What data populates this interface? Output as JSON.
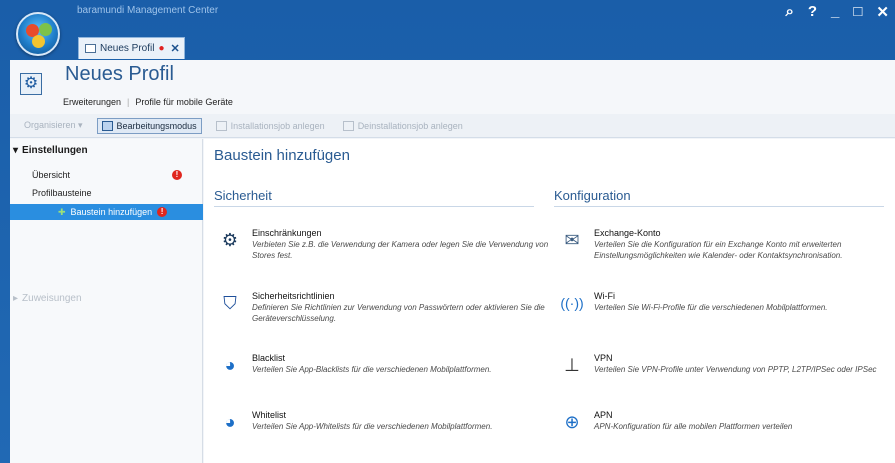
{
  "app": {
    "title": "baramundi Management Center"
  },
  "window_controls": {
    "search": "⌕",
    "help": "?",
    "minimize": "_",
    "maximize": "□",
    "close": "✕"
  },
  "tab": {
    "label": "Neues Profil",
    "modified_marker": "●",
    "close": "✕"
  },
  "header": {
    "title": "Neues Profil",
    "breadcrumb": [
      "Erweiterungen",
      "Profile für mobile Geräte"
    ],
    "breadcrumb_sep": "|"
  },
  "toolbar": {
    "items": [
      {
        "label": "Organisieren ▾",
        "enabled": false
      },
      {
        "label": "Bearbeitungsmodus",
        "enabled": true
      },
      {
        "label": "Installationsjob anlegen",
        "enabled": false
      },
      {
        "label": "Deinstallationsjob anlegen",
        "enabled": false
      }
    ]
  },
  "sidebar": {
    "section1": {
      "label": "Einstellungen",
      "toggle": "▾"
    },
    "items": [
      {
        "label": "Übersicht",
        "error": "!"
      },
      {
        "label": "Profilbausteine"
      },
      {
        "label": "Baustein hinzufügen",
        "error": "!"
      }
    ],
    "section2": {
      "label": "Zuweisungen",
      "toggle": "▸"
    }
  },
  "main": {
    "title": "Baustein hinzufügen",
    "columns": [
      {
        "heading": "Sicherheit",
        "cards": [
          {
            "icon": "gear-icon",
            "title": "Einschränkungen",
            "desc": "Verbieten Sie z.B. die Verwendung der Kamera oder legen Sie die Verwendung von Stores fest."
          },
          {
            "icon": "shield-icon",
            "title": "Sicherheitsrichtlinien",
            "desc": "Definieren Sie Richtlinien zur Verwendung von Passwörtern oder aktivieren Sie die Geräteverschlüsselung."
          },
          {
            "icon": "blacklist-icon",
            "title": "Blacklist",
            "desc": "Verteilen Sie App-Blacklists für die verschiedenen Mobilplattformen."
          },
          {
            "icon": "whitelist-icon",
            "title": "Whitelist",
            "desc": "Verteilen Sie App-Whitelists für die verschiedenen Mobilplattformen."
          }
        ]
      },
      {
        "heading": "Konfiguration",
        "cards": [
          {
            "icon": "mail-icon",
            "title": "Exchange-Konto",
            "desc": "Verteilen Sie die Konfiguration für ein Exchange Konto mit erweiterten Einstellungsmöglichkeiten wie Kalender- oder Kontaktsynchronisation."
          },
          {
            "icon": "wifi-icon",
            "title": "Wi-Fi",
            "desc": "Verteilen Sie Wi-Fi-Profile für die verschiedenen Mobilplattformen."
          },
          {
            "icon": "vpn-icon",
            "title": "VPN",
            "desc": "Verteilen Sie VPN-Profile unter Verwendung von PPTP, L2TP/IPSec oder IPSec"
          },
          {
            "icon": "globe-icon",
            "title": "APN",
            "desc": "APN-Konfiguration für alle mobilen Plattformen verteilen"
          }
        ]
      }
    ]
  },
  "colors": {
    "accent": "#2a5b92",
    "selection": "#2a8ee0",
    "error": "#e0261e",
    "frame": "#1f64b0"
  }
}
